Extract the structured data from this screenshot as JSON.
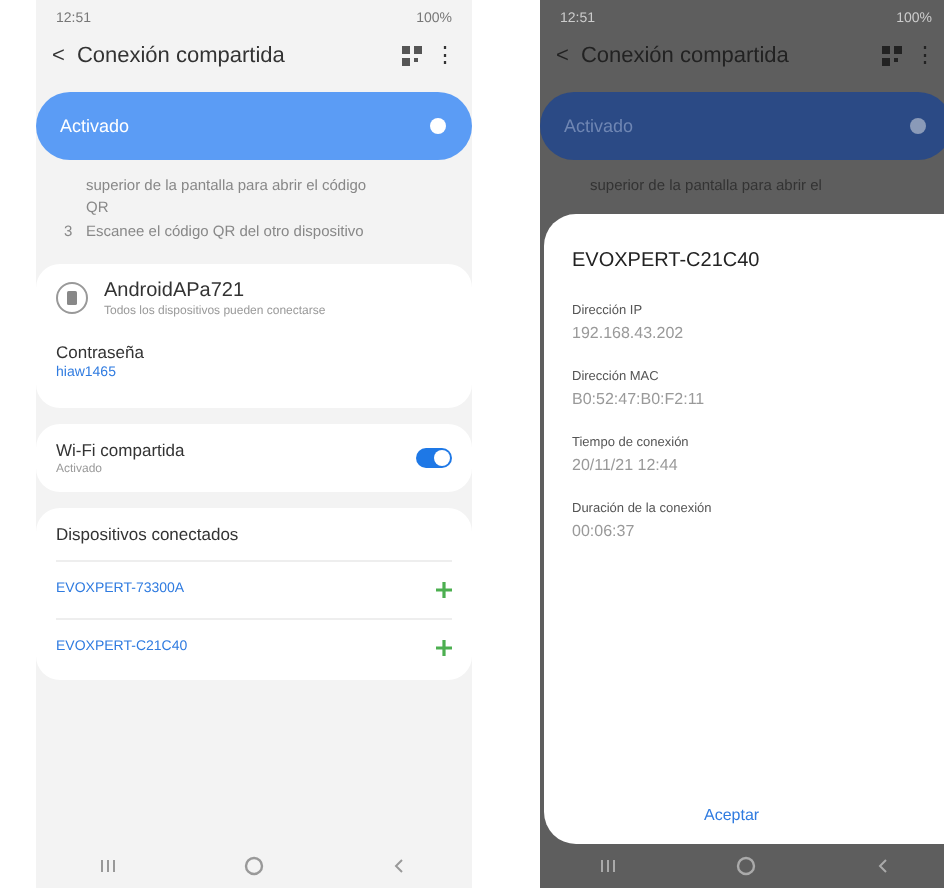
{
  "left_screen": {
    "status_bar": {
      "time": "12:51",
      "battery": "100%"
    },
    "header": {
      "back": "<",
      "title": "Conexión compartida",
      "menu": "⋮"
    },
    "hotspot": {
      "label": "Activado",
      "on": true
    },
    "instructions": [
      {
        "text": "superior de la pantalla para abrir el código QR"
      },
      {
        "number": "3",
        "text": "Escanee el código QR del otro dispositivo"
      }
    ],
    "network": {
      "name": "AndroidAPa721",
      "subtitle": "Todos los dispositivos pueden conectarse"
    },
    "password": {
      "label": "Contraseña",
      "value": "hiaw1465"
    },
    "wifi_sharing": {
      "label": "Wi-Fi compartida",
      "status": "Activado",
      "on": true
    },
    "devices": {
      "title": "Dispositivos conectados",
      "items": [
        {
          "name": "EVOXPERT-73300A"
        },
        {
          "name": "EVOXPERT-C21C40"
        }
      ]
    }
  },
  "right_screen": {
    "status_bar": {
      "time": "12:51",
      "battery": "100%"
    },
    "header": {
      "back": "<",
      "title": "Conexión compartida",
      "menu": "⋮"
    },
    "hotspot": {
      "label": "Activado",
      "on": true
    },
    "instruction": "superior de la pantalla para abrir el",
    "dialog": {
      "title": "EVOXPERT-C21C40",
      "fields": [
        {
          "label": "Dirección IP",
          "value": "192.168.43.202"
        },
        {
          "label": "Dirección MAC",
          "value": "B0:52:47:B0:F2:11"
        },
        {
          "label": "Tiempo de conexión",
          "value": "20/11/21 12:44"
        },
        {
          "label": "Duración de la conexión",
          "value": "00:06:37"
        }
      ],
      "button": "Aceptar"
    }
  }
}
